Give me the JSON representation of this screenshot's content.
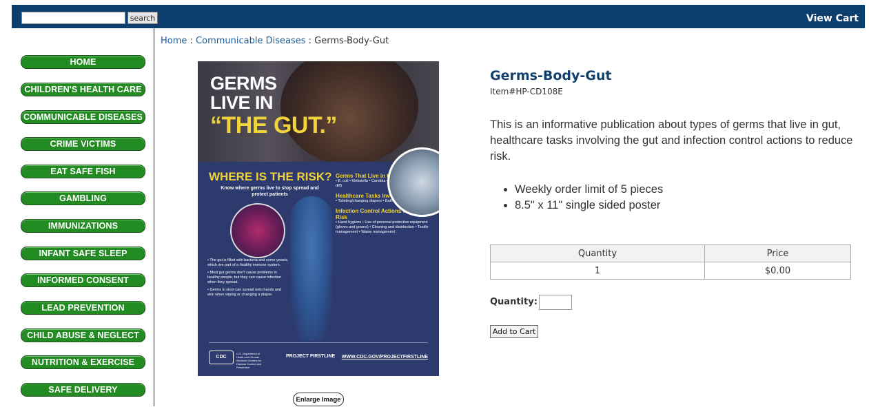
{
  "header": {
    "search_placeholder": "",
    "search_button": "search",
    "view_cart": "View Cart"
  },
  "sidebar": {
    "items": [
      {
        "label": "HOME"
      },
      {
        "label": "CHILDREN'S HEALTH CARE"
      },
      {
        "label": "COMMUNICABLE DISEASES"
      },
      {
        "label": "CRIME VICTIMS"
      },
      {
        "label": "EAT SAFE FISH"
      },
      {
        "label": "GAMBLING"
      },
      {
        "label": "IMMUNIZATIONS"
      },
      {
        "label": "INFANT SAFE SLEEP"
      },
      {
        "label": "INFORMED CONSENT"
      },
      {
        "label": "LEAD PREVENTION"
      },
      {
        "label": "CHILD ABUSE & NEGLECT"
      },
      {
        "label": "NUTRITION & EXERCISE"
      },
      {
        "label": "SAFE DELIVERY"
      }
    ]
  },
  "breadcrumb": {
    "home": "Home",
    "sep1": " : ",
    "category": "Communicable Diseases",
    "sep2": " : ",
    "current": "Germs-Body-Gut"
  },
  "poster": {
    "headline_1": "GERMS",
    "headline_2": "LIVE IN",
    "headline_3": "“THE GUT.”",
    "risk_title": "WHERE IS THE RISK?",
    "risk_subtitle": "Know where germs live to stop spread and protect patients",
    "left_text_1": "• The gut is filled with bacteria and some yeasts, which are part of a healthy immune system.",
    "left_text_2": "• Most gut germs don't cause problems in healthy people, but they can cause infection when they spread.",
    "left_text_3": "• Germs in stool can spread onto hands and skin when wiping or changing a diaper.",
    "col_h1": "Germs That Live in the Gut",
    "col_b1": "• E. coli  • Klebsiella  • Candida  • Clostridioides difficile (C. diff)",
    "col_h2": "Healthcare Tasks Involving the Gut",
    "col_b2": "• Toileting/changing diapers  • Bathing a patient  • Laundry",
    "col_h3": "Infection Control Actions to Reduce Risk",
    "col_b3": "• Hand hygiene  • Use of personal protective equipment (gloves and gowns)  • Cleaning and disinfection  • Textile management  • Waste management",
    "cdc": "CDC",
    "hhs": "U.S. Department of Health and Human Services Centers for Disease Control and Prevention",
    "project": "PROJECT FIRSTLINE",
    "url": "WWW.CDC.GOV/PROJECTFIRSTLINE"
  },
  "enlarge_label": "Enlarge Image",
  "product": {
    "title": "Germs-Body-Gut",
    "item_number": "Item#HP-CD108E",
    "description": "This is an informative publication about types of germs that live in gut, healthcare tasks involving the gut and infection control actions to reduce risk.",
    "bullets": [
      "Weekly order limit of 5 pieces",
      "8.5\" x 11\" single sided poster"
    ],
    "table": {
      "headers": [
        "Quantity",
        "Price"
      ],
      "row": [
        "1",
        "$0.00"
      ]
    },
    "quantity_label": "Quantity:",
    "quantity_value": "",
    "add_to_cart": "Add to Cart"
  }
}
